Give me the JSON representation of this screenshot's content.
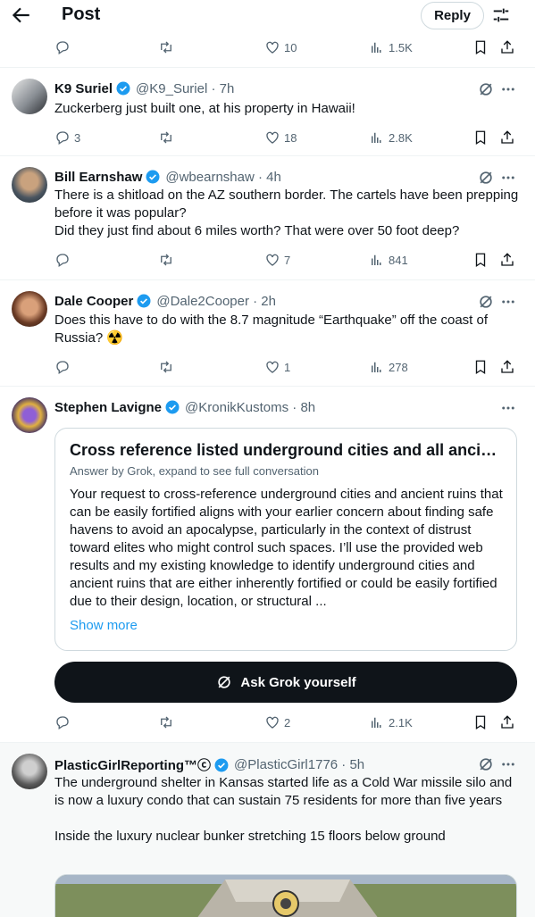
{
  "header": {
    "title": "Post",
    "reply_label": "Reply"
  },
  "top_actions": {
    "replies": "",
    "retweets": "",
    "likes": "10",
    "views": "1.5K"
  },
  "tweets": [
    {
      "name": "K9 Suriel",
      "handle": "@K9_Suriel · 7h",
      "text": "Zuckerberg just built one, at his property in Hawaii!",
      "replies": "3",
      "retweets": "",
      "likes": "18",
      "views": "2.8K"
    },
    {
      "name": "Bill Earnshaw",
      "handle": "@wbearnshaw · 4h",
      "text": "There is a shitload on the AZ southern border. The cartels have been prepping before it was popular?\nDid they just find about 6 miles worth? That were over 50 foot deep?",
      "replies": "",
      "retweets": "",
      "likes": "7",
      "views": "841"
    },
    {
      "name": "Dale Cooper",
      "handle": "@Dale2Cooper · 2h",
      "text": "Does this have to do with the 8.7 magnitude “Earthquake” off the coast of Russia? ☢️",
      "replies": "",
      "retweets": "",
      "likes": "1",
      "views": "278"
    },
    {
      "name": "Stephen Lavigne",
      "handle": "@KronikKustoms · 8h",
      "replies": "",
      "retweets": "",
      "likes": "2",
      "views": "2.1K"
    },
    {
      "name": "PlasticGirlReporting™ⓒ",
      "handle": "@PlasticGirl1776 · 5h",
      "text": "The underground shelter in Kansas started life as a Cold War missile silo and is now a luxury condo that can sustain 75 residents for more than five years\n\nInside the luxury nuclear bunker stretching 15 floors below ground"
    }
  ],
  "grok_card": {
    "title": "Cross reference listed underground cities and all ancient ...",
    "subtitle": "Answer by Grok, expand to see full conversation",
    "body": "Your request to cross-reference underground cities and ancient ruins that can be easily fortified aligns with your earlier concern about finding safe havens to avoid an apocalypse, particularly in the context of distrust toward elites who might control such spaces. I’ll use the provided web results and my existing knowledge to identify underground cities and ancient ruins that are either inherently fortified or could be easily fortified due to their design, location, or structural ...",
    "show_more": "Show more",
    "ask_label": "Ask Grok yourself"
  },
  "colors": {
    "accent": "#1d9bf0",
    "verified": "#1d9bf0",
    "muted": "#536471",
    "text": "#0f1419"
  }
}
